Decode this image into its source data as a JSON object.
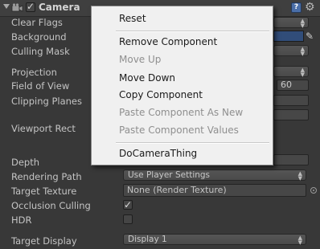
{
  "header": {
    "title": "Camera",
    "enabled": true
  },
  "properties": [
    {
      "label": "Clear Flags"
    },
    {
      "label": "Background"
    },
    {
      "label": "Culling Mask"
    },
    {
      "label": "Projection"
    },
    {
      "label": "Field of View",
      "value": "60"
    },
    {
      "label": "Clipping Planes"
    },
    {
      "label": "Viewport Rect"
    },
    {
      "label": "Depth"
    },
    {
      "label": "Rendering Path",
      "value": "Use Player Settings"
    },
    {
      "label": "Target Texture",
      "value": "None (Render Texture)"
    },
    {
      "label": "Occlusion Culling",
      "checked": true
    },
    {
      "label": "HDR",
      "checked": false
    },
    {
      "label": "Target Display",
      "value": "Display 1"
    }
  ],
  "colors": {
    "background_swatch": "#314d79"
  },
  "context_menu": {
    "items": [
      {
        "label": "Reset",
        "enabled": true
      },
      {
        "label": "Remove Component",
        "enabled": true
      },
      {
        "label": "Move Up",
        "enabled": false
      },
      {
        "label": "Move Down",
        "enabled": true
      },
      {
        "label": "Copy Component",
        "enabled": true
      },
      {
        "label": "Paste Component As New",
        "enabled": false
      },
      {
        "label": "Paste Component Values",
        "enabled": false
      },
      {
        "label": "DoCameraThing",
        "enabled": true
      }
    ]
  }
}
